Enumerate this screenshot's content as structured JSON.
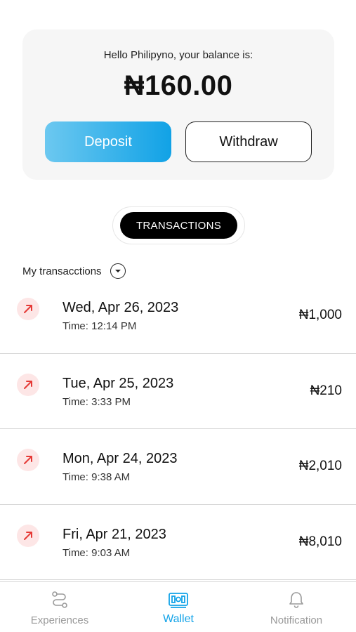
{
  "balance_card": {
    "greeting": "Hello Philipyno, your balance is:",
    "amount": "₦160.00",
    "deposit_label": "Deposit",
    "withdraw_label": "Withdraw"
  },
  "tabs": {
    "active_label": "TRANSACTIONS"
  },
  "filter": {
    "label": "My transacctions",
    "icon": "chevron-down-icon"
  },
  "transactions": [
    {
      "date": "Wed, Apr 26, 2023",
      "time": "Time: 12:14 PM",
      "amount": "₦1,000",
      "icon": "arrow-up-right-icon"
    },
    {
      "date": "Tue, Apr 25, 2023",
      "time": "Time: 3:33 PM",
      "amount": "₦210",
      "icon": "arrow-up-right-icon"
    },
    {
      "date": "Mon, Apr 24, 2023",
      "time": "Time: 9:38 AM",
      "amount": "₦2,010",
      "icon": "arrow-up-right-icon"
    },
    {
      "date": "Fri, Apr 21, 2023",
      "time": "Time: 9:03 AM",
      "amount": "₦8,010",
      "icon": "arrow-up-right-icon"
    }
  ],
  "bottom_nav": {
    "items": [
      {
        "label": "Experiences",
        "icon": "route-icon"
      },
      {
        "label": "Wallet",
        "icon": "wallet-icon",
        "active": true
      },
      {
        "label": "Notification",
        "icon": "bell-icon"
      }
    ]
  },
  "colors": {
    "accent": "#12a3e8",
    "deposit_gradient_start": "#6cc8f0",
    "outgoing_icon": "#e53935",
    "outgoing_icon_bg": "#fde6e6"
  }
}
